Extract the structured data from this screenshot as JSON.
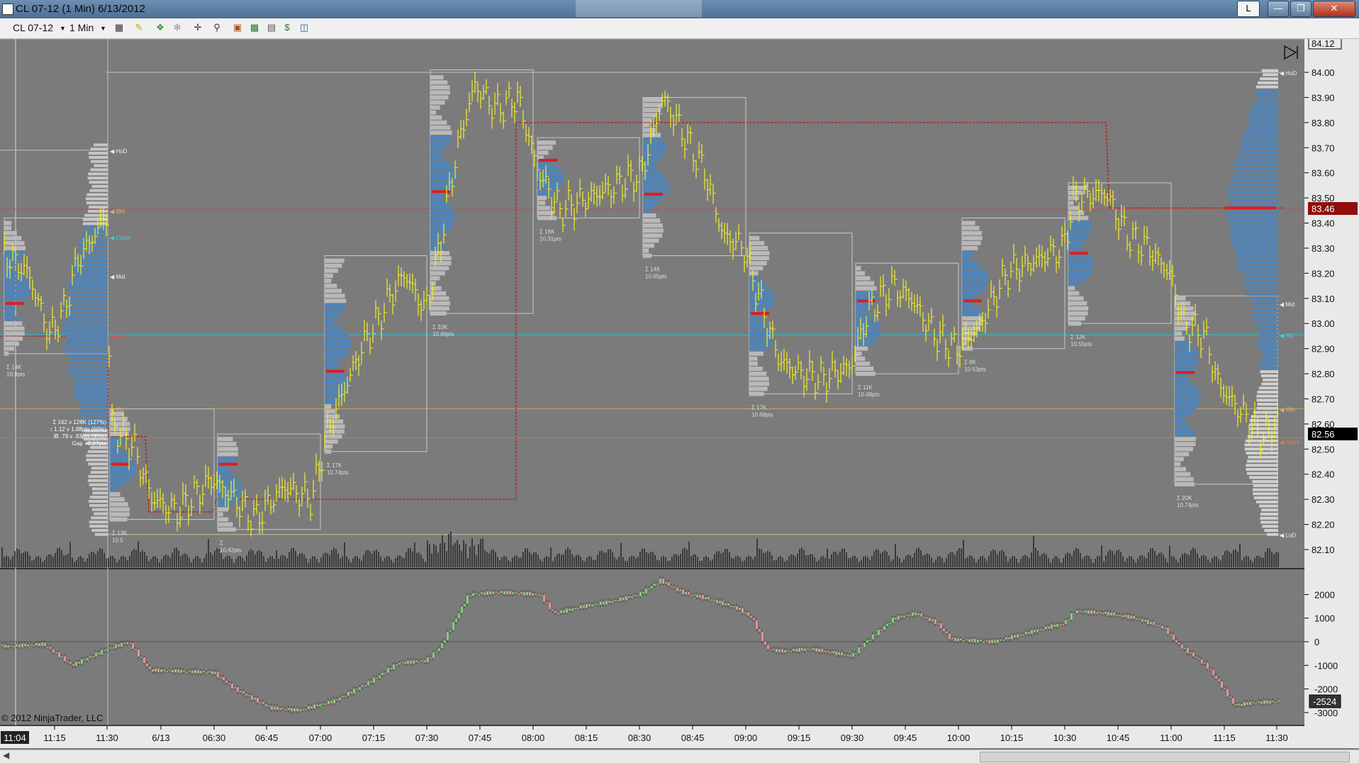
{
  "window": {
    "title": "CL 07-12 (1 Min)  6/13/2012",
    "btn_l": "L"
  },
  "toolbar": {
    "instrument": "CL 07-12",
    "interval": "1 Min"
  },
  "chart": {
    "last_price": "83.46",
    "current_price": "82.56",
    "top_price": "84.12",
    "indicator_value": "-2524",
    "copyright": "© 2012 NinjaTrader, LLC",
    "cursor_time": "11:04",
    "price_labels": [
      "84.00",
      "83.90",
      "83.80",
      "83.70",
      "83.60",
      "83.50",
      "83.40",
      "83.30",
      "83.20",
      "83.10",
      "83.00",
      "82.90",
      "82.80",
      "82.70",
      "82.60",
      "82.50",
      "82.40",
      "82.30",
      "82.20",
      "82.10"
    ],
    "indicator_labels": [
      "2000",
      "1000",
      "0",
      "-1000",
      "-2000",
      "-3000"
    ],
    "time_labels": [
      "11:15",
      "11:30",
      "6/13",
      "06:30",
      "06:45",
      "07:00",
      "07:15",
      "07:30",
      "07:45",
      "08:00",
      "08:15",
      "08:30",
      "08:45",
      "09:00",
      "09:15",
      "09:30",
      "09:45",
      "10:00",
      "10:15",
      "10:30",
      "10:45",
      "11:00",
      "11:15",
      "11:30"
    ],
    "markers": [
      "HoD",
      "IBH",
      "Close",
      "Mid",
      "POC",
      "IBL",
      "LoD",
      "HG",
      "Open"
    ],
    "stats_box": [
      "Σ 162 v 128K (127%)",
      "↕ 1.12 v 1.88pts (60%)",
      "IB .79 v .83pts (95%)",
      "Gap +0.07pts"
    ],
    "box_labels": [
      {
        "vol": "Σ 14K",
        "range": "10.9pts"
      },
      {
        "vol": "Σ 13K",
        "range": "10.5"
      },
      {
        "vol": "Σ",
        "range": "10.42pts"
      },
      {
        "vol": "Σ 17K",
        "range": "10.74pts"
      },
      {
        "vol": "Σ 33K",
        "range": "10.89pts"
      },
      {
        "vol": "Σ 16K",
        "range": "10.31pts"
      },
      {
        "vol": "Σ 14K",
        "range": "10.65pts"
      },
      {
        "vol": "Σ 17K",
        "range": "10.68pts"
      },
      {
        "vol": "Σ 11K",
        "range": "10.48pts"
      },
      {
        "vol": "Σ 8K",
        "range": "10.53pts"
      },
      {
        "vol": "Σ 12K",
        "range": "10.55pts"
      },
      {
        "vol": "Σ 20K",
        "range": "10.74pts"
      }
    ]
  }
}
